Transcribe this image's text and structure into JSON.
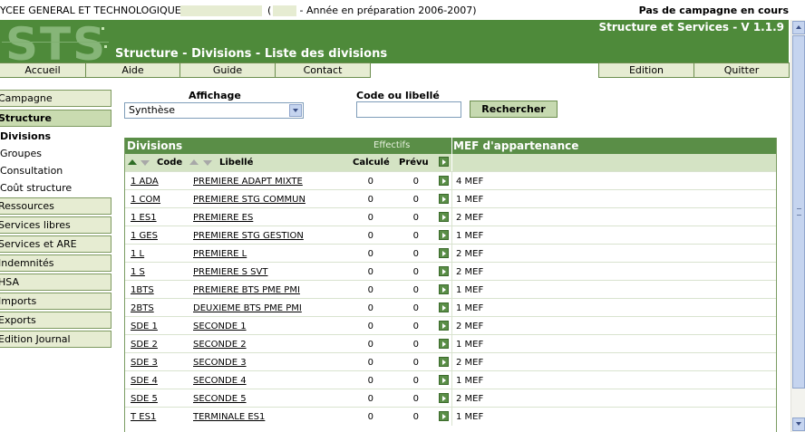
{
  "topline": {
    "school": "YCEE GENERAL ET TECHNOLOGIQUE",
    "year_info": "(        004J - Année en préparation 2006-2007)",
    "campaign": "Pas de campagne en cours"
  },
  "header": {
    "logo_text": "STS",
    "app_title": "Structure et Services - V 1.1.9",
    "page_title": "Structure - Divisions - Liste des divisions"
  },
  "nav": {
    "accueil": "Accueil",
    "aide": "Aide",
    "guide": "Guide",
    "contact": "Contact",
    "edition": "Edition",
    "quitter": "Quitter"
  },
  "sidebar": {
    "campagne": "Campagne",
    "structure": "Structure",
    "sub": {
      "divisions": "Divisions",
      "groupes": "Groupes",
      "consultation": "Consultation",
      "cout": "Coût structure"
    },
    "ressources": "Ressources",
    "services_libres": "Services libres",
    "services_are": "Services et ARE",
    "indemnites": "Indemnités",
    "hsa": "HSA",
    "imports": "Imports",
    "exports": "Exports",
    "edition_journal": "Edition Journal"
  },
  "filters": {
    "affichage_label": "Affichage",
    "affichage_value": "Synthèse",
    "code_label": "Code ou libellé",
    "code_value": "",
    "search_button": "Rechercher"
  },
  "table": {
    "divisions_title": "Divisions",
    "effectifs_title": "Effectifs",
    "mef_title": "MEF d'appartenance",
    "col_code": "Code",
    "col_libelle": "Libellé",
    "col_calcule": "Calculé",
    "col_prevu": "Prévu",
    "rows": [
      {
        "code": "1 ADA",
        "libelle": "PREMIERE ADAPT MIXTE",
        "calcule": "0",
        "prevu": "0",
        "mef": "4 MEF"
      },
      {
        "code": "1 COM",
        "libelle": "PREMIERE STG COMMUN",
        "calcule": "0",
        "prevu": "0",
        "mef": "1 MEF"
      },
      {
        "code": "1 ES1",
        "libelle": "PREMIERE ES",
        "calcule": "0",
        "prevu": "0",
        "mef": "2 MEF"
      },
      {
        "code": "1 GES",
        "libelle": "PREMIERE STG GESTION",
        "calcule": "0",
        "prevu": "0",
        "mef": "1 MEF"
      },
      {
        "code": "1 L",
        "libelle": "PREMIERE L",
        "calcule": "0",
        "prevu": "0",
        "mef": "2 MEF"
      },
      {
        "code": "1 S",
        "libelle": "PREMIERE S SVT",
        "calcule": "0",
        "prevu": "0",
        "mef": "2 MEF"
      },
      {
        "code": "1BTS",
        "libelle": "PREMIERE BTS PME PMI",
        "calcule": "0",
        "prevu": "0",
        "mef": "1 MEF"
      },
      {
        "code": "2BTS",
        "libelle": "DEUXIEME BTS PME PMI",
        "calcule": "0",
        "prevu": "0",
        "mef": "1 MEF"
      },
      {
        "code": "SDE 1",
        "libelle": "SECONDE 1",
        "calcule": "0",
        "prevu": "0",
        "mef": "2 MEF"
      },
      {
        "code": "SDE 2",
        "libelle": "SECONDE 2",
        "calcule": "0",
        "prevu": "0",
        "mef": "1 MEF"
      },
      {
        "code": "SDE 3",
        "libelle": "SECONDE 3",
        "calcule": "0",
        "prevu": "0",
        "mef": "2 MEF"
      },
      {
        "code": "SDE 4",
        "libelle": "SECONDE 4",
        "calcule": "0",
        "prevu": "0",
        "mef": "1 MEF"
      },
      {
        "code": "SDE 5",
        "libelle": "SECONDE 5",
        "calcule": "0",
        "prevu": "0",
        "mef": "2 MEF"
      },
      {
        "code": "T ES1",
        "libelle": "TERMINALE ES1",
        "calcule": "0",
        "prevu": "0",
        "mef": "1 MEF"
      }
    ]
  },
  "colors": {
    "header_green": "#4e8a3a",
    "light_green": "#e6ecd2",
    "table_header": "#5a8e47",
    "subheader": "#d4e3c4"
  }
}
